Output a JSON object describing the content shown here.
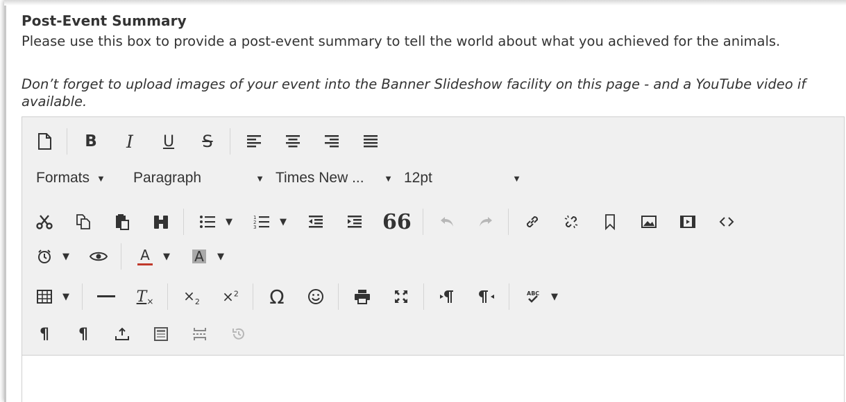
{
  "section": {
    "heading": "Post-Event Summary",
    "description": "Please use this box to provide a post-event summary to tell the world about what you achieved for the animals.",
    "note": "Don’t forget to upload images of your event into the Banner Slideshow facility on this page - and a YouTube video if available."
  },
  "toolbar": {
    "bold_label": "B",
    "italic_label": "I",
    "underline_label": "U",
    "strike_label": "S",
    "formats_label": "Formats",
    "block_value": "Paragraph",
    "font_value": "Times New ...",
    "size_value": "12pt",
    "quote_label": "66",
    "omega_label": "Ω",
    "pilcrow_label": "¶",
    "clear_format_label": "T"
  },
  "colors": {
    "toolbar_bg": "#f0f0f0",
    "border": "#cfcfcf",
    "text": "#333333",
    "disabled": "#b7b7b7"
  }
}
